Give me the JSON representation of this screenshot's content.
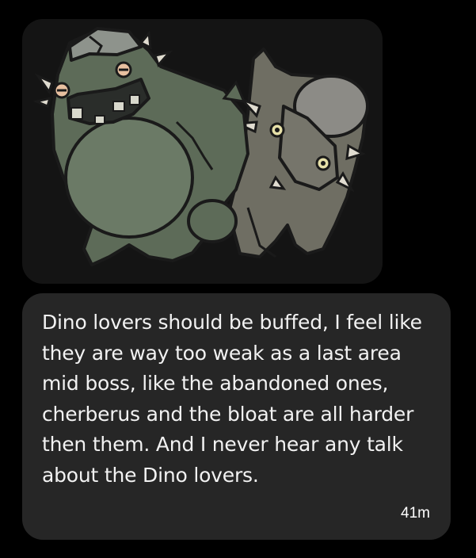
{
  "message": {
    "image": {
      "description_icon": "dino-lovers-image"
    },
    "text": "Dino lovers should be buffed, I feel like they are way too weak as a last area mid boss, like the abandoned ones, cherberus and the bloat are all harder then them. And I never hear any talk about the Dino lovers.",
    "time": "41m"
  },
  "colors": {
    "background": "#000000",
    "image_bubble_bg": "#141414",
    "text_bubble_bg": "#262626",
    "text": "#f2f2f2",
    "creature_left": "#5d6b58",
    "creature_right": "#6f6e63"
  }
}
